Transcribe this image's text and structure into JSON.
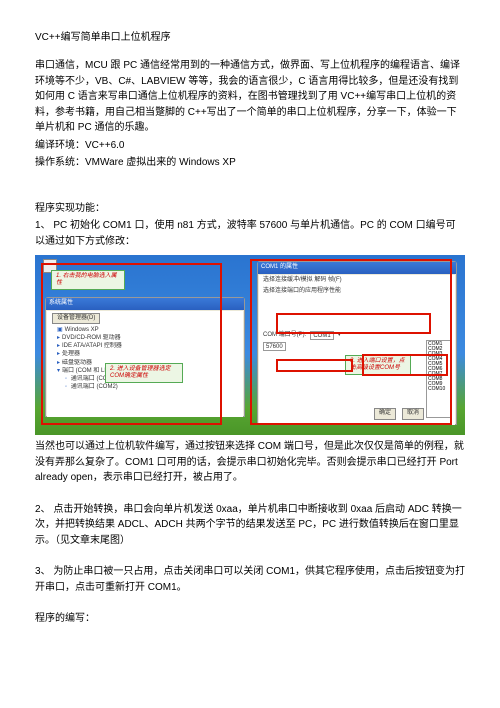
{
  "title": "VC++编写简单串口上位机程序",
  "intro": "串口通信，MCU 跟 PC 通信经常用到的一种通信方式，做界面、写上位机程序的编程语言、编译环境等不少，VB、C#、LABVIEW 等等，我会的语言很少，C 语言用得比较多，但是还没有找到如何用 C 语言来写串口通信上位机程序的资料，在图书管理找到了用 VC++编写串口上位机的资料，参考书籍，用自己相当蹩脚的 C++写出了一个简单的串口上位机程序，分享一下，体验一下单片机和 PC 通信的乐趣。",
  "env_label": "编译环境：",
  "env_value": "VC++6.0",
  "os_label": "操作系统：",
  "os_value": "VMWare 虚拟出来的 Windows XP",
  "func_header": "程序实现功能：",
  "func1": "1、 PC 初始化 COM1 口，使用 n81 方式，波特率 57600 与单片机通信。PC 的 COM 口编号可以通过如下方式修改：",
  "callouts": {
    "c1": "1. 右击我的电脑选入属性",
    "c2": "2. 进入设备管理器选定COM确定属性",
    "c3": "3. 进入端口设置，点击高级设置COM号"
  },
  "windows": {
    "left_title": "系统属性",
    "right_title": "COM1 的属性",
    "tree": [
      "Windows XP",
      "DVD/CD-ROM 驱动器",
      "IDE ATA/ATAPI 控制器",
      "处理器",
      "磁盘驱动器",
      "端口 (COM 和 LPT)",
      "  通讯端口 (COM1)",
      "  通讯端口 (COM2)"
    ],
    "right_fields": {
      "label1": "选择连接缓冲/模拟 解码 帧(F)",
      "label2": "选择连接端口的应用程序性能",
      "com_label": "COM 端口号(P):",
      "com_value": "COM1",
      "baud_row": "57600",
      "misc": "设备管理器(D)"
    },
    "list_items": [
      "COM1",
      "COM2",
      "COM3",
      "COM4",
      "COM5",
      "COM6",
      "COM7",
      "COM8",
      "COM9",
      "COM10"
    ],
    "buttons": {
      "ok": "确定",
      "cancel": "取消"
    }
  },
  "after_image": "当然也可以通过上位机软件编写，通过按钮来选择 COM 端口号，但是此次仅仅是简单的例程，就没有弄那么复杂了。COM1 口可用的话，会提示串口初始化完毕。否则会提示串口已经打开 Port already open，表示串口已经打开，被占用了。",
  "func2": "2、 点击开始转换，串口会向单片机发送 0xaa，单片机串口中断接收到 0xaa 后启动 ADC 转换一次，并把转换结果 ADCL、ADCH 共两个字节的结果发送至 PC，PC 进行数值转换后在窗口里显示。（见文章末尾图）",
  "func3": "3、 为防止串口被一只占用，点击关闭串口可以关闭 COM1，供其它程序使用，点击后按钮变为打开串口，点击可重新打开 COM1。",
  "code_header": "程序的编写："
}
